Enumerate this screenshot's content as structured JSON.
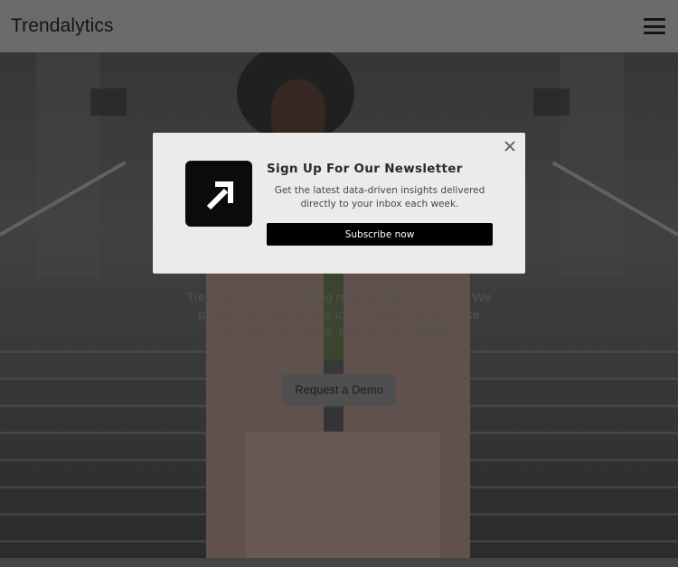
{
  "header": {
    "logo_text": "Trendalytics",
    "menu_icon": "hamburger-menu-icon"
  },
  "hero": {
    "description": "Trendalytics is the leading retail analytics platform. We partner with businesses to anticipate trends, make disruptive decisions, and drive profitability.",
    "demo_button_label": "Request a Demo"
  },
  "modal": {
    "title": "Sign Up For Our Newsletter",
    "description": "Get the latest data-driven insights delivered directly to your inbox each week.",
    "subscribe_button_label": "Subscribe now",
    "close_icon": "close-icon",
    "logo_icon": "arrow-up-right-logo-icon"
  },
  "colors": {
    "header_bg": "#6b6b6b",
    "modal_bg": "#ebebeb",
    "button_bg": "#000000",
    "logo_bg": "#0b0b0b"
  }
}
